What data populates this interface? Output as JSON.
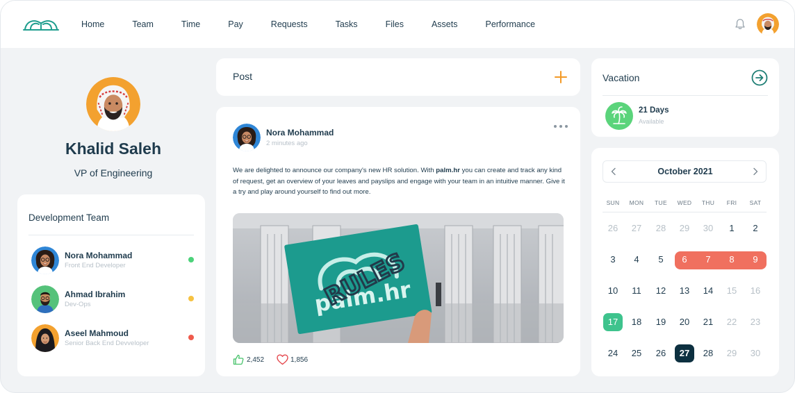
{
  "nav": {
    "items": [
      "Home",
      "Team",
      "Time",
      "Pay",
      "Requests",
      "Tasks",
      "Files",
      "Assets",
      "Performance"
    ]
  },
  "profile": {
    "name": "Khalid Saleh",
    "role": "VP of Engineering"
  },
  "team": {
    "title": "Development Team",
    "members": [
      {
        "name": "Nora Mohammad",
        "role": "Front End Developer",
        "status_color": "#4cd27a"
      },
      {
        "name": "Ahmad Ibrahim",
        "role": "Dev-Ops",
        "status_color": "#f6c242"
      },
      {
        "name": "Aseel Mahmoud",
        "role": "Senior Back End Devveloper",
        "status_color": "#ef5a4c"
      }
    ]
  },
  "composer": {
    "label": "Post"
  },
  "feed_post": {
    "author": "Nora Mohammad",
    "time": "2 minutes ago",
    "text_before": "We are delighted to announce our company's new HR solution. With ",
    "text_brand": "palm.hr",
    "text_after": " you can create and track any kind of request, get an overview of your leaves and payslips and engage with your team in an intuitive manner. Give it a try and play around yourself to find out more.",
    "image_sign_word": "RULES",
    "image_sign_brand": "palm.hr",
    "likes": "2,452",
    "hearts": "1,856"
  },
  "vacation": {
    "title": "Vacation",
    "days": "21 Days",
    "status": "Available"
  },
  "calendar": {
    "month": "October 2021",
    "weekdays": [
      "SUN",
      "MON",
      "TUE",
      "WED",
      "THU",
      "FRI",
      "SAT"
    ],
    "weeks": [
      [
        "26",
        "27",
        "28",
        "29",
        "30",
        "1",
        "2"
      ],
      [
        "3",
        "4",
        "5",
        "6",
        "7",
        "8",
        "9"
      ],
      [
        "10",
        "11",
        "12",
        "13",
        "14",
        "15",
        "16"
      ],
      [
        "17",
        "18",
        "19",
        "20",
        "21",
        "22",
        "23"
      ],
      [
        "24",
        "25",
        "26",
        "27",
        "28",
        "29",
        "30"
      ]
    ]
  },
  "colors": {
    "brand_teal": "#1f9e8e",
    "accent_orange": "#f39a26",
    "range_coral": "#f0705f",
    "today_green": "#3ec38d",
    "selected_navy": "#0d3040"
  }
}
